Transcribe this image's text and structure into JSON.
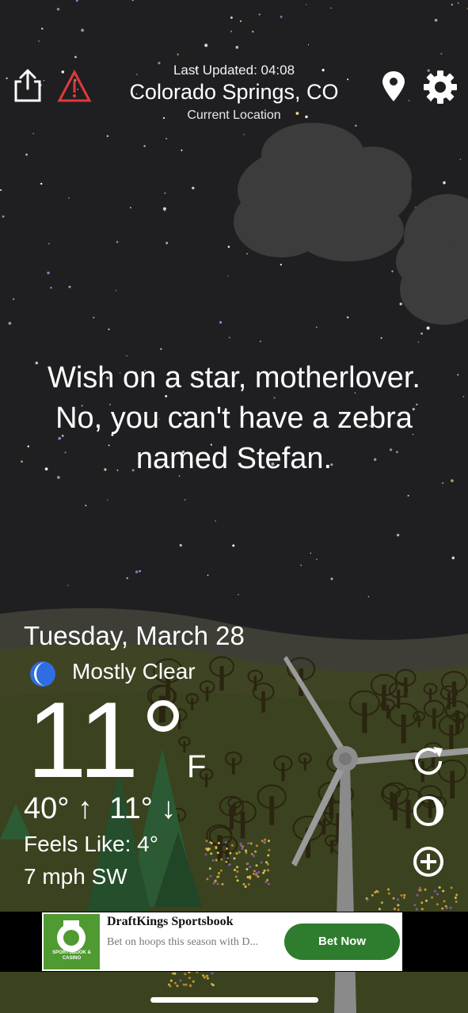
{
  "header": {
    "last_updated": "Last Updated: 04:08",
    "city": "Colorado Springs, CO",
    "location_label": "Current Location"
  },
  "quote": {
    "lines": [
      "Wish on a star, motherlover.",
      "No, you can't have a zebra",
      "named Stefan."
    ]
  },
  "weather": {
    "date": "Tuesday, March 28",
    "condition": "Mostly Clear",
    "condition_icon": "crescent-moon-icon",
    "temperature": "11",
    "unit": "F",
    "hi_lo": "40° ↑  11° ↓",
    "feels_like": "Feels Like: 4°",
    "wind": "7 mph SW"
  },
  "icons": {
    "share": "share-icon",
    "alert": "warning-triangle-icon",
    "location": "location-pin-icon",
    "settings": "gear-icon",
    "refresh": "refresh-icon",
    "theme": "theme-toggle-icon",
    "add": "add-circle-icon"
  },
  "ad": {
    "title": "DraftKings Sportsbook",
    "description": "Bet on hoops this season with D...",
    "button": "Bet Now",
    "logo_text": "SPORTSBOOK & CASINO"
  },
  "colors": {
    "sky": "#1f1f22",
    "alert": "#e03a3a",
    "moon": "#2f6ee0",
    "ad_button": "#2e7d2e",
    "ad_logo": "#4f9a31"
  }
}
